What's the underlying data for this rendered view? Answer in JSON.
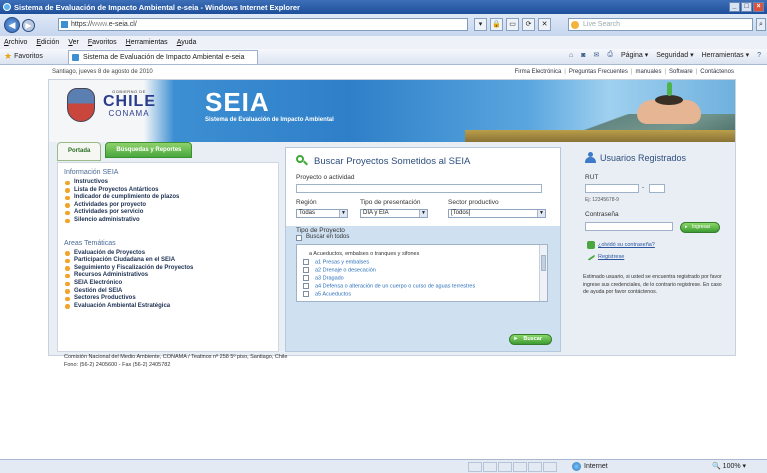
{
  "browser": {
    "title": "Sistema de Evaluación de Impacto Ambiental e-seia - Windows Internet Explorer",
    "url_prefix": "https://",
    "url_grey": "www.",
    "url_rest": "e-seia.cl/",
    "live_search_placeholder": "Live Search",
    "menu": [
      "Archivo",
      "Edición",
      "Ver",
      "Favoritos",
      "Herramientas",
      "Ayuda"
    ],
    "favorites_label": "Favoritos",
    "tab_title": "Sistema de Evaluación de Impacto Ambiental e-seia",
    "command_bar": [
      "Página ▾",
      "Seguridad ▾",
      "Herramientas ▾"
    ],
    "status_zone": "Internet",
    "status_zoom": "100%"
  },
  "page": {
    "date": "Santiago, jueves 8 de agosto de 2010",
    "top_links": [
      "Firma Electrónica",
      "Preguntas Frecuentes",
      "manuales",
      "Software",
      "Contáctenos"
    ],
    "logo": {
      "gobierno": "GOBIERNO DE",
      "chile": "CHILE",
      "conama": "CONAMA"
    },
    "banner_title": "SEIA",
    "banner_subtitle": "Sistema de Evaluación de Impacto Ambiental",
    "tabs": [
      "Portada",
      "Búsquedas y Reportes"
    ],
    "info_section": {
      "heading": "Información SEIA",
      "items": [
        "Instructivos",
        "Lista de Proyectos Antárticos",
        "Indicador de cumplimiento de plazos",
        "Actividades por proyecto",
        "Actividades por servicio",
        "Silencio administrativo"
      ]
    },
    "areas_section": {
      "heading": "Areas Temáticas",
      "items": [
        "Evaluación de Proyectos",
        "Participación Ciudadana en el SEIA",
        "Seguimiento y Fiscalización de Proyectos",
        "Recursos Administrativos",
        "SEIA Electrónico",
        "Gestión del SEIA",
        "Sectores Productivos",
        "Evaluación Ambiental Estratégica"
      ]
    },
    "search": {
      "title": "Buscar Proyectos Sometidos al SEIA",
      "project_label": "Proyecto o actividad",
      "project_value": "",
      "region_label": "Región",
      "region_value": "Todas",
      "tipo_label": "Tipo de presentación",
      "tipo_value": "DIA y EIA",
      "sector_label": "Sector productivo",
      "sector_value": "[Todos]",
      "tipo_proyecto_label": "Tipo de Proyecto",
      "buscar_todos": "Buscar en todos",
      "group_header": "a Acueductos, embalses o tranques y sifones",
      "project_types": [
        "a1 Presas y embalses",
        "a2 Drenaje o desecación",
        "a3 Dragado",
        "a4 Defensa o alteración de un cuerpo o curso de aguas terrestres",
        "a5 Acueductos"
      ],
      "buscar_button": "Buscar"
    },
    "login": {
      "title": "Usuarios Registrados",
      "rut_label": "RUT",
      "rut_example": "Ej: 12345678-9",
      "password_label": "Contraseña",
      "ingresar_button": "Ingresar",
      "forgot_link": "¿olvidó su contraseña?",
      "register_link": "Registrese",
      "note": "Estimado usuario, si usted se encuentra registrado por favor ingrese sus credenciales, de lo contrario registrese. En caso de ayuda por favor contáctenos."
    },
    "footer": {
      "line1": "Comisión Nacional del Medio Ambiente, CONAMA / Teatinos nº 258 5º piso, Santiago, Chile",
      "line2": "Fono: (56-2) 2405600 - Fax (56-2) 2405782"
    }
  }
}
